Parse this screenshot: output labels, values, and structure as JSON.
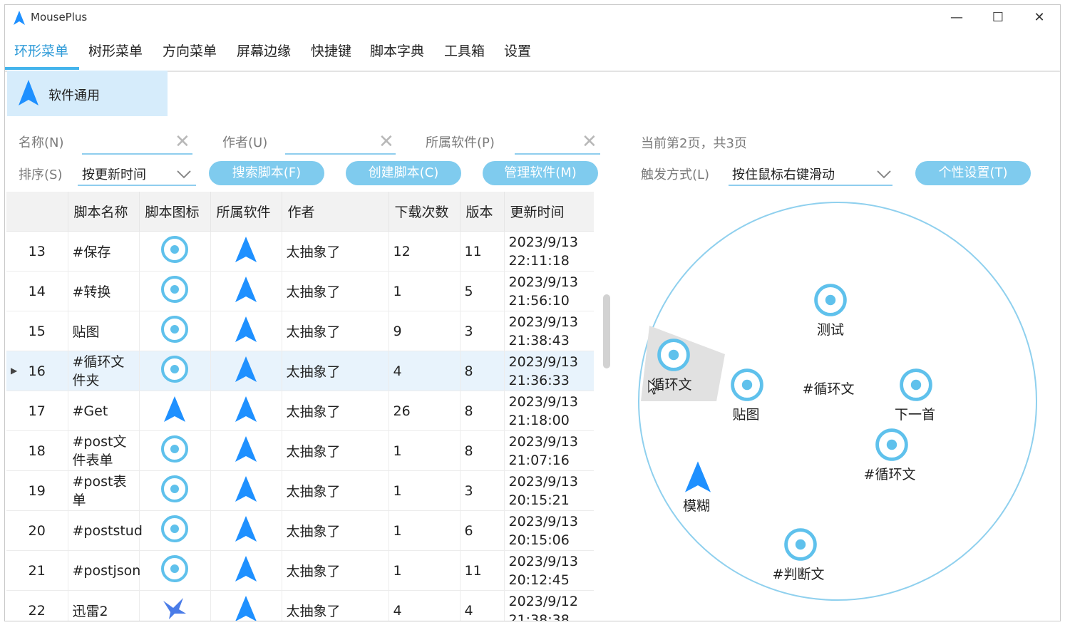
{
  "app": {
    "title": "MousePlus"
  },
  "window_controls": {
    "minimize": "—",
    "maximize": "☐",
    "close": "✕"
  },
  "tabs": [
    {
      "label": "环形菜单"
    },
    {
      "label": "树形菜单"
    },
    {
      "label": "方向菜单"
    },
    {
      "label": "屏幕边缘"
    },
    {
      "label": "快捷键"
    },
    {
      "label": "脚本字典"
    },
    {
      "label": "工具箱"
    },
    {
      "label": "设置"
    }
  ],
  "category": {
    "label": "软件通用"
  },
  "filters": {
    "name_label": "名称(N)",
    "author_label": "作者(U)",
    "software_label": "所属软件(P)",
    "page_info": "当前第2页，共3页",
    "sort_label": "排序(S)",
    "sort_value": "按更新时间",
    "search_button": "搜索脚本(F)",
    "create_button": "创建脚本(C)",
    "manage_button": "管理软件(M)",
    "trigger_label": "触发方式(L)",
    "trigger_value": "按住鼠标右键滑动",
    "personalize_button": "个性设置(T)"
  },
  "table": {
    "headers": [
      "",
      "脚本名称",
      "脚本图标",
      "所属软件",
      "作者",
      "下载次数",
      "版本",
      "更新时间"
    ],
    "rows": [
      {
        "index": "13",
        "name": "#保存",
        "name2": "",
        "icon": "target-icon",
        "author": "太抽象了",
        "downloads": "12",
        "version": "11",
        "date": "2023/9/13",
        "time": "22:11:18"
      },
      {
        "index": "14",
        "name": "#转换",
        "name2": "",
        "icon": "target-icon",
        "author": "太抽象了",
        "downloads": "1",
        "version": "5",
        "date": "2023/9/13",
        "time": "21:56:10"
      },
      {
        "index": "15",
        "name": "贴图",
        "name2": "",
        "icon": "target-icon",
        "author": "太抽象了",
        "downloads": "9",
        "version": "3",
        "date": "2023/9/13",
        "time": "21:38:43"
      },
      {
        "index": "16",
        "name": "#循环文",
        "name2": "件夹",
        "icon": "target-icon",
        "author": "太抽象了",
        "downloads": "4",
        "version": "8",
        "date": "2023/9/13",
        "time": "21:36:33",
        "selected": true
      },
      {
        "index": "17",
        "name": "#Get",
        "name2": "",
        "icon": "arrow-icon",
        "author": "太抽象了",
        "downloads": "26",
        "version": "8",
        "date": "2023/9/13",
        "time": "21:18:00"
      },
      {
        "index": "18",
        "name": "#post文",
        "name2": "件表单",
        "icon": "target-icon",
        "author": "太抽象了",
        "downloads": "1",
        "version": "8",
        "date": "2023/9/13",
        "time": "21:07:16"
      },
      {
        "index": "19",
        "name": "#post表",
        "name2": "单",
        "icon": "target-icon",
        "author": "太抽象了",
        "downloads": "1",
        "version": "3",
        "date": "2023/9/13",
        "time": "20:15:21"
      },
      {
        "index": "20",
        "name": "#poststud",
        "name2": "",
        "icon": "target-icon",
        "author": "太抽象了",
        "downloads": "1",
        "version": "6",
        "date": "2023/9/13",
        "time": "20:15:06"
      },
      {
        "index": "21",
        "name": "#postjson",
        "name2": "",
        "icon": "target-icon",
        "author": "太抽象了",
        "downloads": "1",
        "version": "11",
        "date": "2023/9/13",
        "time": "20:12:45"
      },
      {
        "index": "22",
        "name": "迅雷2",
        "name2": "",
        "icon": "bird-icon",
        "author": "太抽象了",
        "downloads": "4",
        "version": "4",
        "date": "2023/9/12",
        "time": "21:38:38"
      }
    ]
  },
  "ring_menu": {
    "items": [
      {
        "label": "测试",
        "icon": "target-icon"
      },
      {
        "label": "循环文",
        "icon": "target-icon"
      },
      {
        "label": "贴图",
        "icon": "target-icon"
      },
      {
        "label": "#循环文",
        "icon": ""
      },
      {
        "label": "下一首",
        "icon": "target-icon"
      },
      {
        "label": "#循环文",
        "icon": "target-icon"
      },
      {
        "label": "模糊",
        "icon": "arrow-icon"
      },
      {
        "label": "#判断文",
        "icon": "target-icon"
      }
    ]
  },
  "colors": {
    "accent": "#2f9bd8",
    "button": "#7fcbee",
    "selected_row": "#e8f3fc",
    "category_bg": "#d6ecfb",
    "ring": "#8fd0ee"
  }
}
